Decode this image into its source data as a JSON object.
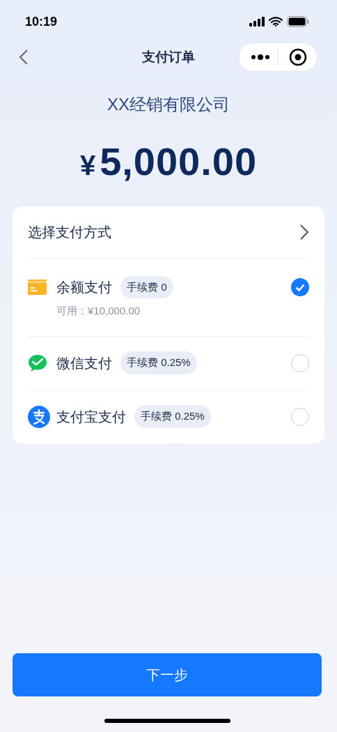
{
  "status_bar": {
    "time": "10:19"
  },
  "nav": {
    "title": "支付订单"
  },
  "merchant": "XX经销有限公司",
  "amount": {
    "currency": "¥",
    "value": "5,000.00"
  },
  "payment": {
    "header": "选择支付方式",
    "methods": [
      {
        "kind": "balance",
        "name": "余额支付",
        "fee": "手续费 0",
        "available": "可用：¥10,000.00",
        "selected": true
      },
      {
        "kind": "wechat",
        "name": "微信支付",
        "fee": "手续费 0.25%",
        "selected": false
      },
      {
        "kind": "alipay",
        "name": "支付宝支付",
        "fee": "手续费 0.25%",
        "selected": false
      }
    ]
  },
  "next_button": "下一步"
}
